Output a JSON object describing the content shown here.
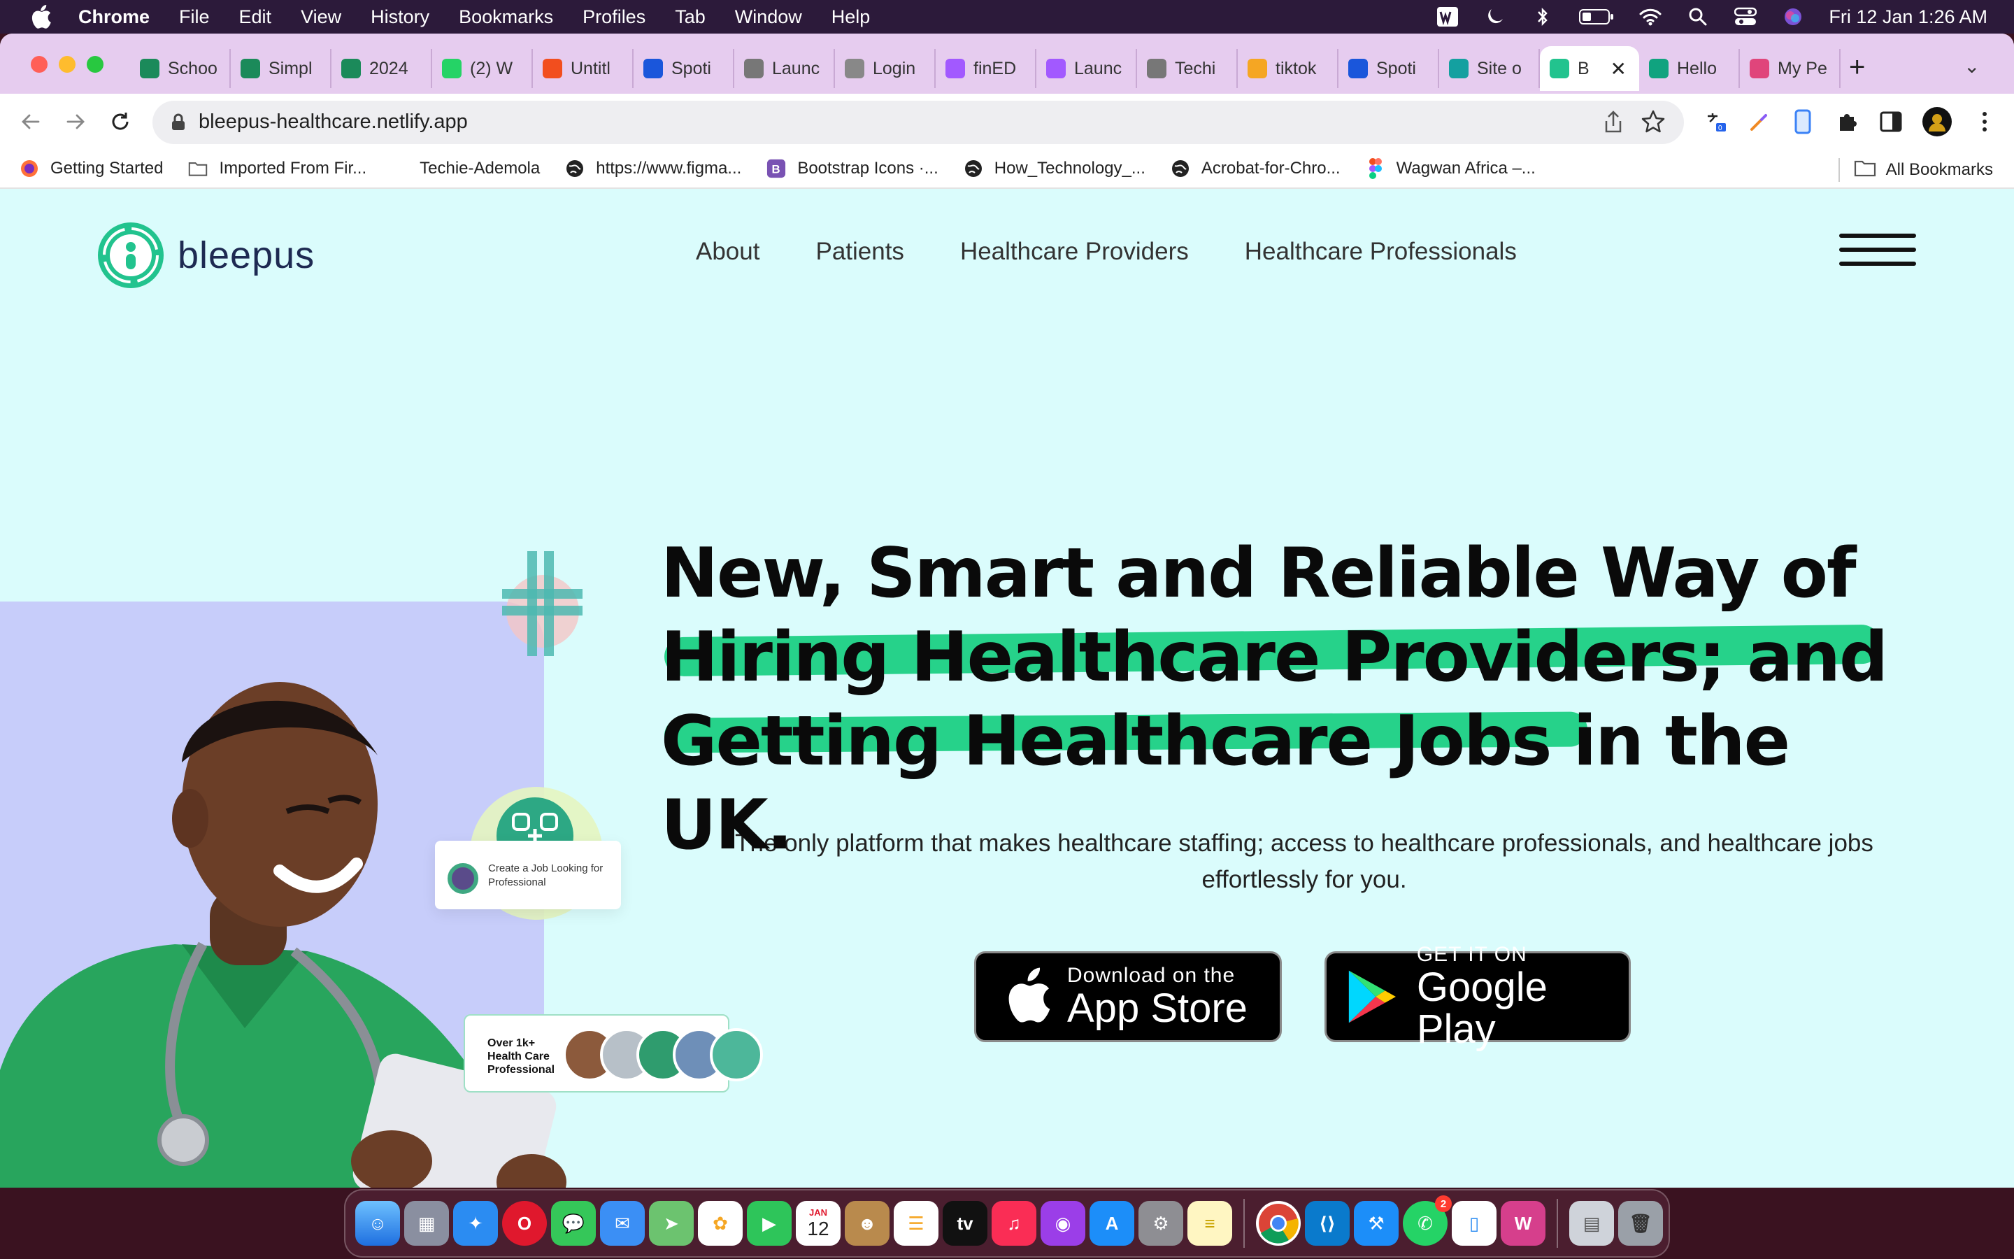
{
  "menubar": {
    "app_name": "Chrome",
    "menus": [
      "File",
      "Edit",
      "View",
      "History",
      "Bookmarks",
      "Profiles",
      "Tab",
      "Window",
      "Help"
    ],
    "clock": "Fri 12 Jan  1:26 AM"
  },
  "tabs": [
    {
      "label": "Schoo",
      "icon": "green-s-icon",
      "color": "#1b8a5a"
    },
    {
      "label": "Simpl",
      "icon": "green-s-icon",
      "color": "#1b8a5a"
    },
    {
      "label": "2024",
      "icon": "green-s-icon",
      "color": "#1b8a5a"
    },
    {
      "label": "(2) W",
      "icon": "whatsapp-icon",
      "color": "#25d366"
    },
    {
      "label": "Untitl",
      "icon": "orange-icon",
      "color": "#f24e1e"
    },
    {
      "label": "Spoti",
      "icon": "blue-r-icon",
      "color": "#1a56db"
    },
    {
      "label": "Launc",
      "icon": "github-icon",
      "color": "#777777"
    },
    {
      "label": "Login",
      "icon": "globe-icon",
      "color": "#888888"
    },
    {
      "label": "finED",
      "icon": "figma-icon",
      "color": "#a259ff"
    },
    {
      "label": "Launc",
      "icon": "figma-icon",
      "color": "#a259ff"
    },
    {
      "label": "Techi",
      "icon": "github-icon",
      "color": "#777777"
    },
    {
      "label": "tiktok",
      "icon": "flame-icon",
      "color": "#f5a623"
    },
    {
      "label": "Spoti",
      "icon": "blue-r-icon",
      "color": "#1a56db"
    },
    {
      "label": "Site o",
      "icon": "diamond-icon",
      "color": "#14a0a0"
    },
    {
      "label": "B",
      "icon": "bleepus-icon",
      "color": "#22c38e",
      "active": true
    },
    {
      "label": "Hello",
      "icon": "openai-icon",
      "color": "#10a37f"
    },
    {
      "label": "My Pe",
      "icon": "gradient-icon",
      "color": "#e0457b"
    }
  ],
  "address_bar": {
    "url": "bleepus-healthcare.netlify.app"
  },
  "bookmarks": [
    {
      "label": "Getting Started",
      "icon": "firefox-icon"
    },
    {
      "label": "Imported From Fir...",
      "icon": "folder-icon"
    },
    {
      "label": "Techie-Ademola",
      "icon": "blank-icon"
    },
    {
      "label": "https://www.figma...",
      "icon": "globe-icon"
    },
    {
      "label": "Bootstrap Icons ·...",
      "icon": "bootstrap-icon"
    },
    {
      "label": "How_Technology_...",
      "icon": "globe-icon"
    },
    {
      "label": "Acrobat-for-Chro...",
      "icon": "globe-icon"
    },
    {
      "label": "Wagwan Africa –...",
      "icon": "figma-icon"
    }
  ],
  "all_bookmarks": "All Bookmarks",
  "site": {
    "logo_text": "bleepus",
    "nav": [
      "About",
      "Patients",
      "Healthcare Providers",
      "Healthcare Professionals"
    ],
    "headline": {
      "line1": "New, Smart and Reliable Way of",
      "line2": "Hiring Healthcare Providers; and",
      "line3": "Getting Healthcare Jobs in the UK."
    },
    "subtitle": "The only platform that makes healthcare staffing; access to healthcare professionals, and healthcare jobs effortlessly for you.",
    "app_store": {
      "small": "Download on the",
      "big": "App Store"
    },
    "google_play": {
      "small": "GET IT ON",
      "big": "Google Play"
    },
    "job_card_text": "Create a Job Looking for Professional",
    "pros_card_text": "Over 1k+ Health Care Professional",
    "accent_color": "#26d28a",
    "page_bg": "#dafcfc"
  },
  "dock": {
    "calendar_month": "JAN",
    "calendar_day": "12",
    "whatsapp_badge": "2"
  }
}
